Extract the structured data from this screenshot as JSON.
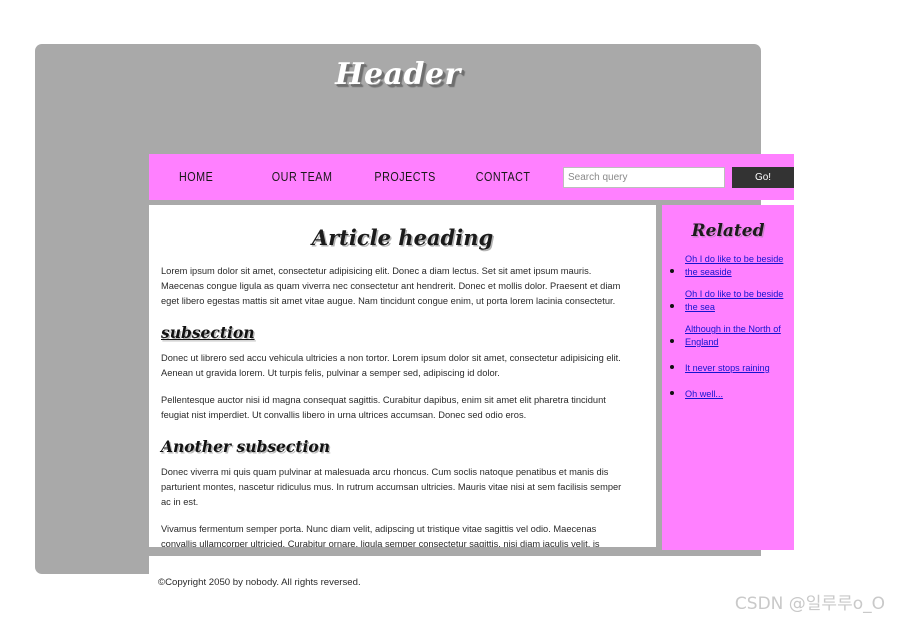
{
  "header": {
    "title": "Header"
  },
  "nav": {
    "links": [
      {
        "label": "HOME"
      },
      {
        "label": "OUR TEAM"
      },
      {
        "label": "PROJECTS"
      },
      {
        "label": "CONTACT"
      }
    ],
    "search": {
      "placeholder": "Search query",
      "value": "",
      "button_label": "Go!"
    }
  },
  "article": {
    "heading": "Article heading",
    "intro_paragraph": "Lorem ipsum dolor sit amet, consectetur adipisicing elit. Donec a diam lectus. Set sit amet ipsum mauris. Maecenas congue ligula as quam viverra nec consectetur ant hendrerit. Donec et mollis dolor. Praesent et diam eget libero egestas mattis sit amet vitae augue. Nam tincidunt congue enim, ut porta lorem lacinia consectetur.",
    "sections": [
      {
        "heading": "subsection",
        "paragraphs": [
          "Donec ut librero sed accu vehicula ultricies a non tortor. Lorem ipsum dolor sit amet, consectetur adipisicing elit. Aenean ut gravida lorem. Ut turpis felis, pulvinar a semper sed, adipiscing id dolor.",
          "Pellentesque auctor nisi id magna consequat sagittis. Curabitur dapibus, enim sit amet elit pharetra tincidunt feugiat nist imperdiet. Ut convallis libero in urna ultrices accumsan. Donec sed odio eros."
        ]
      },
      {
        "heading": "Another subsection",
        "paragraphs": [
          "Donec viverra mi quis quam pulvinar at malesuada arcu rhoncus. Cum soclis natoque penatibus et manis dis parturient montes, nascetur ridiculus mus. In rutrum accumsan ultricies. Mauris vitae nisi at sem facilisis semper ac in est.",
          "Vivamus fermentum semper porta. Nunc diam velit, adipscing ut tristique vitae sagittis vel odio. Maecenas convallis ullamcorper ultricied. Curabitur ornare, ligula semper consectetur sagittis, nisi diam iaculis velit, is fringille sem nunc vet mi."
        ]
      }
    ]
  },
  "sidebar": {
    "heading": "Related",
    "links": [
      {
        "label": "Oh I do like to be beside the seaside"
      },
      {
        "label": "Oh I do like to be beside the sea"
      },
      {
        "label": "Although in the North of England"
      },
      {
        "label": "It never stops raining"
      },
      {
        "label": "Oh well..."
      }
    ]
  },
  "footer": {
    "copyright": "©Copyright 2050 by nobody. All rights reversed."
  },
  "watermark": {
    "text": "CSDN @일루루o_O"
  },
  "colors": {
    "page_background": "#ffffff",
    "wrapper_gray": "#a9a9a9",
    "accent_pink": "#ff80ff",
    "button_dark": "#333333",
    "link_blue": "#1414d0",
    "text_dark": "#2a2a2a"
  }
}
